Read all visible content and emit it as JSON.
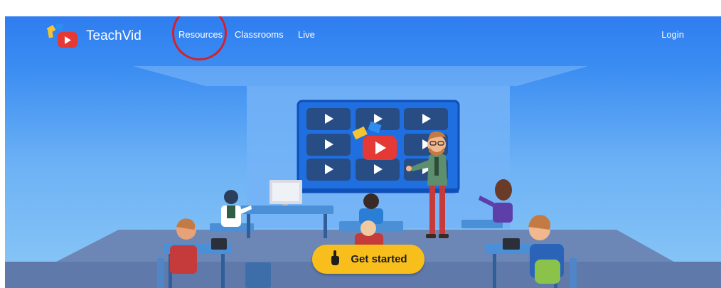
{
  "brand": {
    "name": "TeachVid"
  },
  "nav": {
    "items": [
      "Resources",
      "Classrooms",
      "Live"
    ],
    "login": "Login"
  },
  "hero": {
    "cta_label": "Get started"
  },
  "colors": {
    "header_blue": "#2f7df0",
    "sky_blue": "#8cc8f6",
    "cta_yellow": "#f8bf1c",
    "play_red": "#e53935",
    "highlight_circle": "#d71f2a"
  }
}
